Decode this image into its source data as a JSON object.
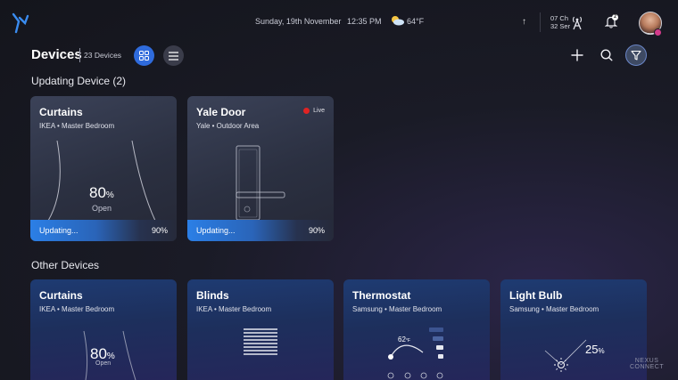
{
  "topbar": {
    "date": "Sunday, 19th November",
    "time": "12:35 PM",
    "temperature": "64°F",
    "upload_arrow": "↑",
    "channel_line1": "07 Ch",
    "channel_line2": "32 Ser",
    "notification_count": "2"
  },
  "header": {
    "title": "Devices",
    "device_count": "23 Devices"
  },
  "updating_section": {
    "title": "Updating Device (2)",
    "cards": [
      {
        "name": "Curtains",
        "subtitle": "IKEA • Master Bedroom",
        "value": "80",
        "unit": "%",
        "state": "Open",
        "update_label": "Updating...",
        "update_progress": "90%"
      },
      {
        "name": "Yale Door",
        "subtitle": "Yale • Outdoor Area",
        "live_label": "Live",
        "update_label": "Updating...",
        "update_progress": "90%"
      }
    ]
  },
  "other_section": {
    "title": "Other Devices",
    "cards": [
      {
        "name": "Curtains",
        "subtitle": "IKEA • Master Bedroom",
        "value": "80",
        "unit": "%",
        "state": "Open"
      },
      {
        "name": "Blinds",
        "subtitle": "IKEA • Master Bedroom"
      },
      {
        "name": "Thermostat",
        "subtitle": "Samsung • Master Bedroom",
        "temp": "62",
        "temp_unit": "°F"
      },
      {
        "name": "Light Bulb",
        "subtitle": "Samsung • Master Bedroom",
        "value": "25",
        "unit": "%"
      }
    ]
  },
  "watermark": {
    "line1": "NEXUS",
    "line2": "CONNECT"
  },
  "colors": {
    "accent": "#2f6bdc",
    "live": "#e02323",
    "badge": "#d43b8b"
  }
}
